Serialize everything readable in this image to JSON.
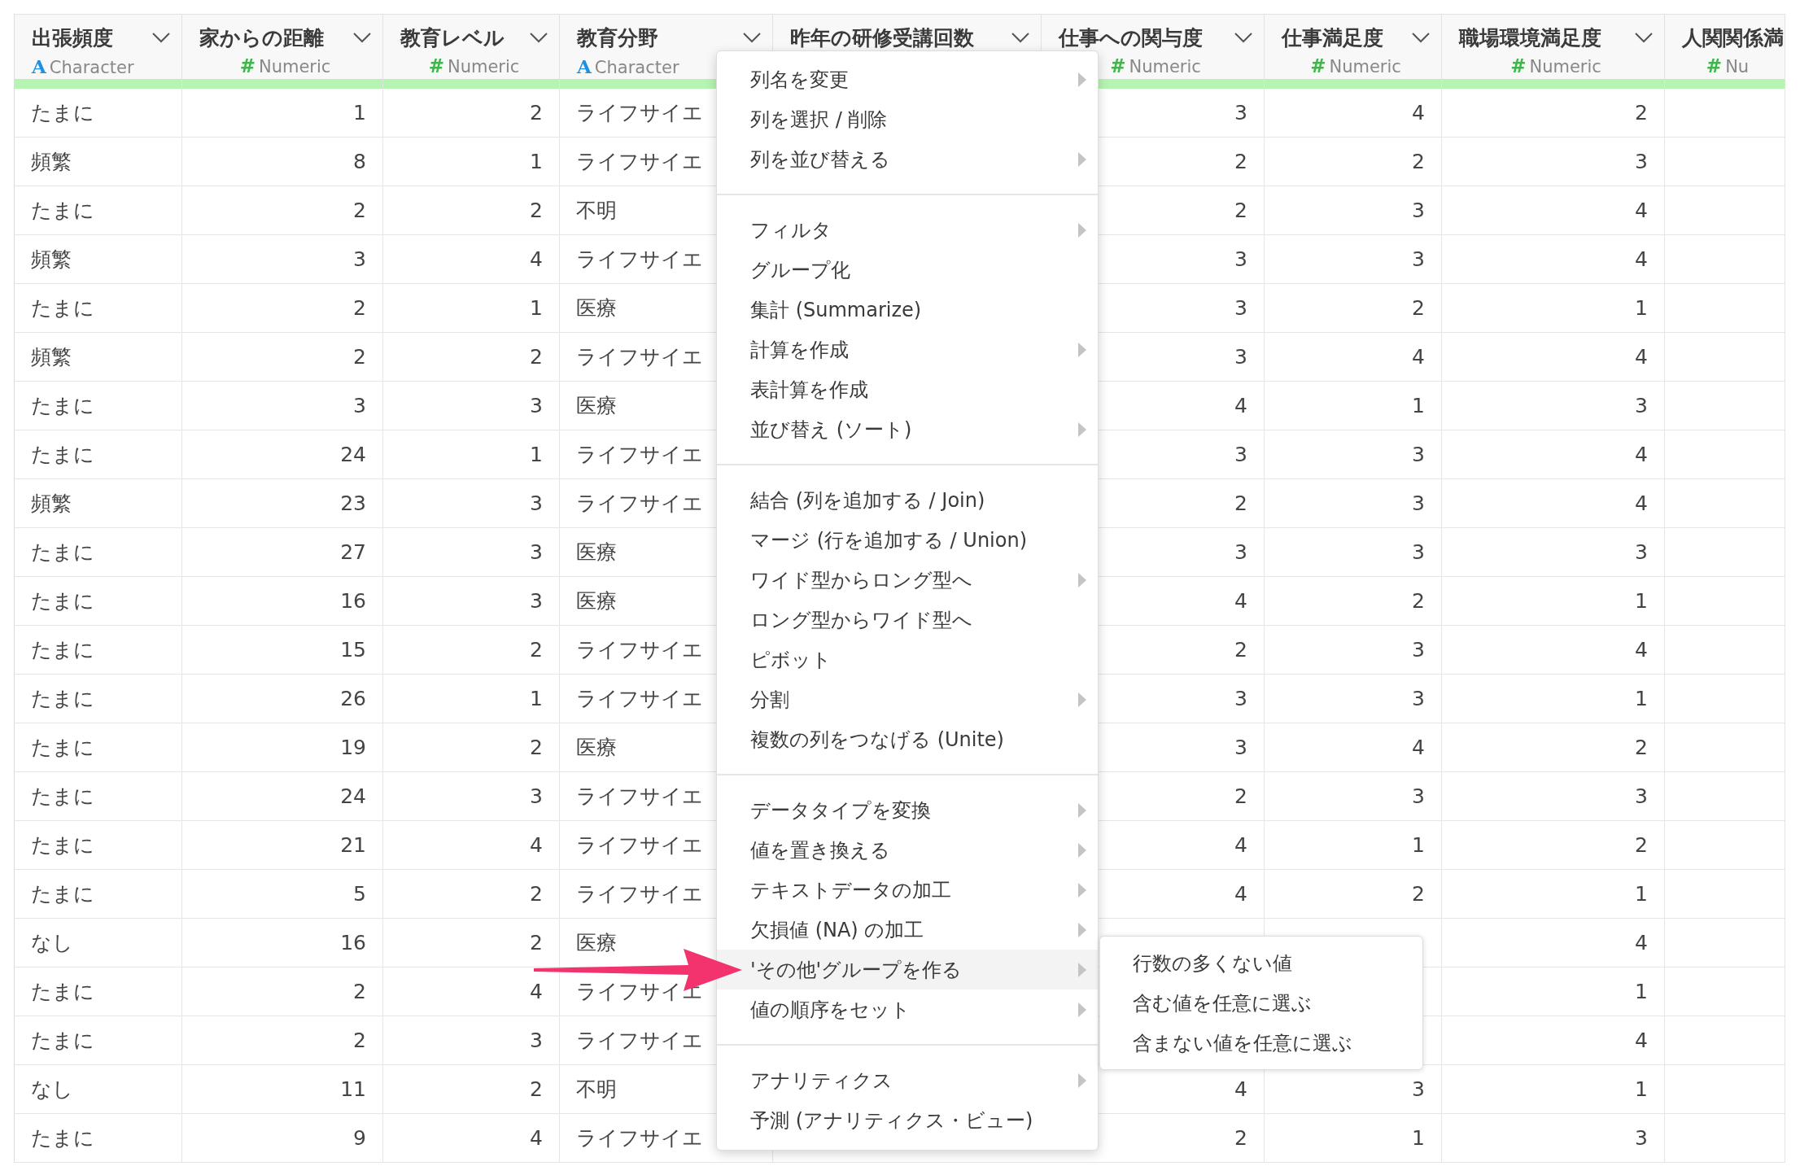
{
  "table": {
    "columns": [
      {
        "name": "出張頻度",
        "type_icon": "A",
        "type": "Character",
        "kind": "character",
        "menu_button": true
      },
      {
        "name": "家からの距離",
        "type_icon": "#",
        "type": "Numeric",
        "kind": "numeric",
        "menu_button": true
      },
      {
        "name": "教育レベル",
        "type_icon": "#",
        "type": "Numeric",
        "kind": "numeric",
        "menu_button": true
      },
      {
        "name": "教育分野",
        "type_icon": "A",
        "type": "Character",
        "kind": "character",
        "menu_button": true
      },
      {
        "name": "昨年の研修受講回数",
        "menu_button": true
      },
      {
        "name": "仕事への関与度",
        "type_icon": "#",
        "type": "Numeric",
        "kind": "numeric",
        "menu_button": true
      },
      {
        "name": "仕事満足度",
        "type_icon": "#",
        "type": "Numeric",
        "kind": "numeric",
        "menu_button": true
      },
      {
        "name": "職場環境満足度",
        "type_icon": "#",
        "type": "Numeric",
        "kind": "numeric",
        "menu_button": true
      },
      {
        "name": "人関関係満",
        "type_icon": "#",
        "type": "Nu",
        "kind": "numeric",
        "menu_button": false
      }
    ],
    "rows": [
      [
        "たまに",
        "1",
        "2",
        "ライフサイエ",
        null,
        "3",
        "4",
        "2",
        null
      ],
      [
        "頻繁",
        "8",
        "1",
        "ライフサイエ",
        null,
        "2",
        "2",
        "3",
        null
      ],
      [
        "たまに",
        "2",
        "2",
        "不明",
        null,
        "2",
        "3",
        "4",
        null
      ],
      [
        "頻繁",
        "3",
        "4",
        "ライフサイエ",
        null,
        "3",
        "3",
        "4",
        null
      ],
      [
        "たまに",
        "2",
        "1",
        "医療",
        null,
        "3",
        "2",
        "1",
        null
      ],
      [
        "頻繁",
        "2",
        "2",
        "ライフサイエ",
        null,
        "3",
        "4",
        "4",
        null
      ],
      [
        "たまに",
        "3",
        "3",
        "医療",
        null,
        "4",
        "1",
        "3",
        null
      ],
      [
        "たまに",
        "24",
        "1",
        "ライフサイエ",
        null,
        "3",
        "3",
        "4",
        null
      ],
      [
        "頻繁",
        "23",
        "3",
        "ライフサイエ",
        null,
        "2",
        "3",
        "4",
        null
      ],
      [
        "たまに",
        "27",
        "3",
        "医療",
        null,
        "3",
        "3",
        "3",
        null
      ],
      [
        "たまに",
        "16",
        "3",
        "医療",
        null,
        "4",
        "2",
        "1",
        null
      ],
      [
        "たまに",
        "15",
        "2",
        "ライフサイエ",
        null,
        "2",
        "3",
        "4",
        null
      ],
      [
        "たまに",
        "26",
        "1",
        "ライフサイエ",
        null,
        "3",
        "3",
        "1",
        null
      ],
      [
        "たまに",
        "19",
        "2",
        "医療",
        null,
        "3",
        "4",
        "2",
        null
      ],
      [
        "たまに",
        "24",
        "3",
        "ライフサイエ",
        null,
        "2",
        "3",
        "3",
        null
      ],
      [
        "たまに",
        "21",
        "4",
        "ライフサイエ",
        null,
        "4",
        "1",
        "2",
        null
      ],
      [
        "たまに",
        "5",
        "2",
        "ライフサイエ",
        null,
        "4",
        "2",
        "1",
        null
      ],
      [
        "なし",
        "16",
        "2",
        "医療",
        null,
        null,
        null,
        "4",
        null
      ],
      [
        "たまに",
        "2",
        "4",
        "ライフサイエ",
        null,
        null,
        null,
        "1",
        null
      ],
      [
        "たまに",
        "2",
        "3",
        "ライフサイエ",
        null,
        null,
        null,
        "4",
        null
      ],
      [
        "なし",
        "11",
        "2",
        "不明",
        null,
        "4",
        "3",
        "1",
        null
      ],
      [
        "たまに",
        "9",
        "4",
        "ライフサイエ",
        null,
        "2",
        "1",
        "3",
        null
      ]
    ]
  },
  "context_menu": {
    "sections": [
      {
        "items": [
          {
            "label": "列名を変更",
            "submenu": true,
            "selected": false
          },
          {
            "label": "列を選択 / 削除",
            "submenu": false,
            "selected": false
          },
          {
            "label": "列を並び替える",
            "submenu": true,
            "selected": false
          }
        ]
      },
      {
        "items": [
          {
            "label": "フィルタ",
            "submenu": true,
            "selected": false
          },
          {
            "label": "グループ化",
            "submenu": false,
            "selected": false
          },
          {
            "label": "集計 (Summarize)",
            "submenu": false,
            "selected": false
          },
          {
            "label": "計算を作成",
            "submenu": true,
            "selected": false
          },
          {
            "label": "表計算を作成",
            "submenu": false,
            "selected": false
          },
          {
            "label": "並び替え (ソート)",
            "submenu": true,
            "selected": false
          }
        ]
      },
      {
        "items": [
          {
            "label": "結合 (列を追加する / Join)",
            "submenu": false,
            "selected": false
          },
          {
            "label": "マージ (行を追加する / Union)",
            "submenu": false,
            "selected": false
          },
          {
            "label": "ワイド型からロング型へ",
            "submenu": true,
            "selected": false
          },
          {
            "label": "ロング型からワイド型へ",
            "submenu": false,
            "selected": false
          },
          {
            "label": "ピボット",
            "submenu": false,
            "selected": false
          },
          {
            "label": "分割",
            "submenu": true,
            "selected": false
          },
          {
            "label": "複数の列をつなげる (Unite)",
            "submenu": false,
            "selected": false
          }
        ]
      },
      {
        "items": [
          {
            "label": "データタイプを変換",
            "submenu": true,
            "selected": false
          },
          {
            "label": "値を置き換える",
            "submenu": true,
            "selected": false
          },
          {
            "label": "テキストデータの加工",
            "submenu": true,
            "selected": false
          },
          {
            "label": "欠損値 (NA) の加工",
            "submenu": true,
            "selected": false
          },
          {
            "label": "'その他'グループを作る",
            "submenu": true,
            "selected": true
          },
          {
            "label": "値の順序をセット",
            "submenu": true,
            "selected": false
          }
        ]
      },
      {
        "items": [
          {
            "label": "アナリティクス",
            "submenu": true,
            "selected": false
          },
          {
            "label": "予測 (アナリティクス・ビュー)",
            "submenu": false,
            "selected": false
          }
        ]
      }
    ]
  },
  "submenu": {
    "items": [
      {
        "label": "行数の多くない値"
      },
      {
        "label": "含む値を任意に選ぶ"
      },
      {
        "label": "含まない値を任意に選ぶ"
      }
    ]
  }
}
